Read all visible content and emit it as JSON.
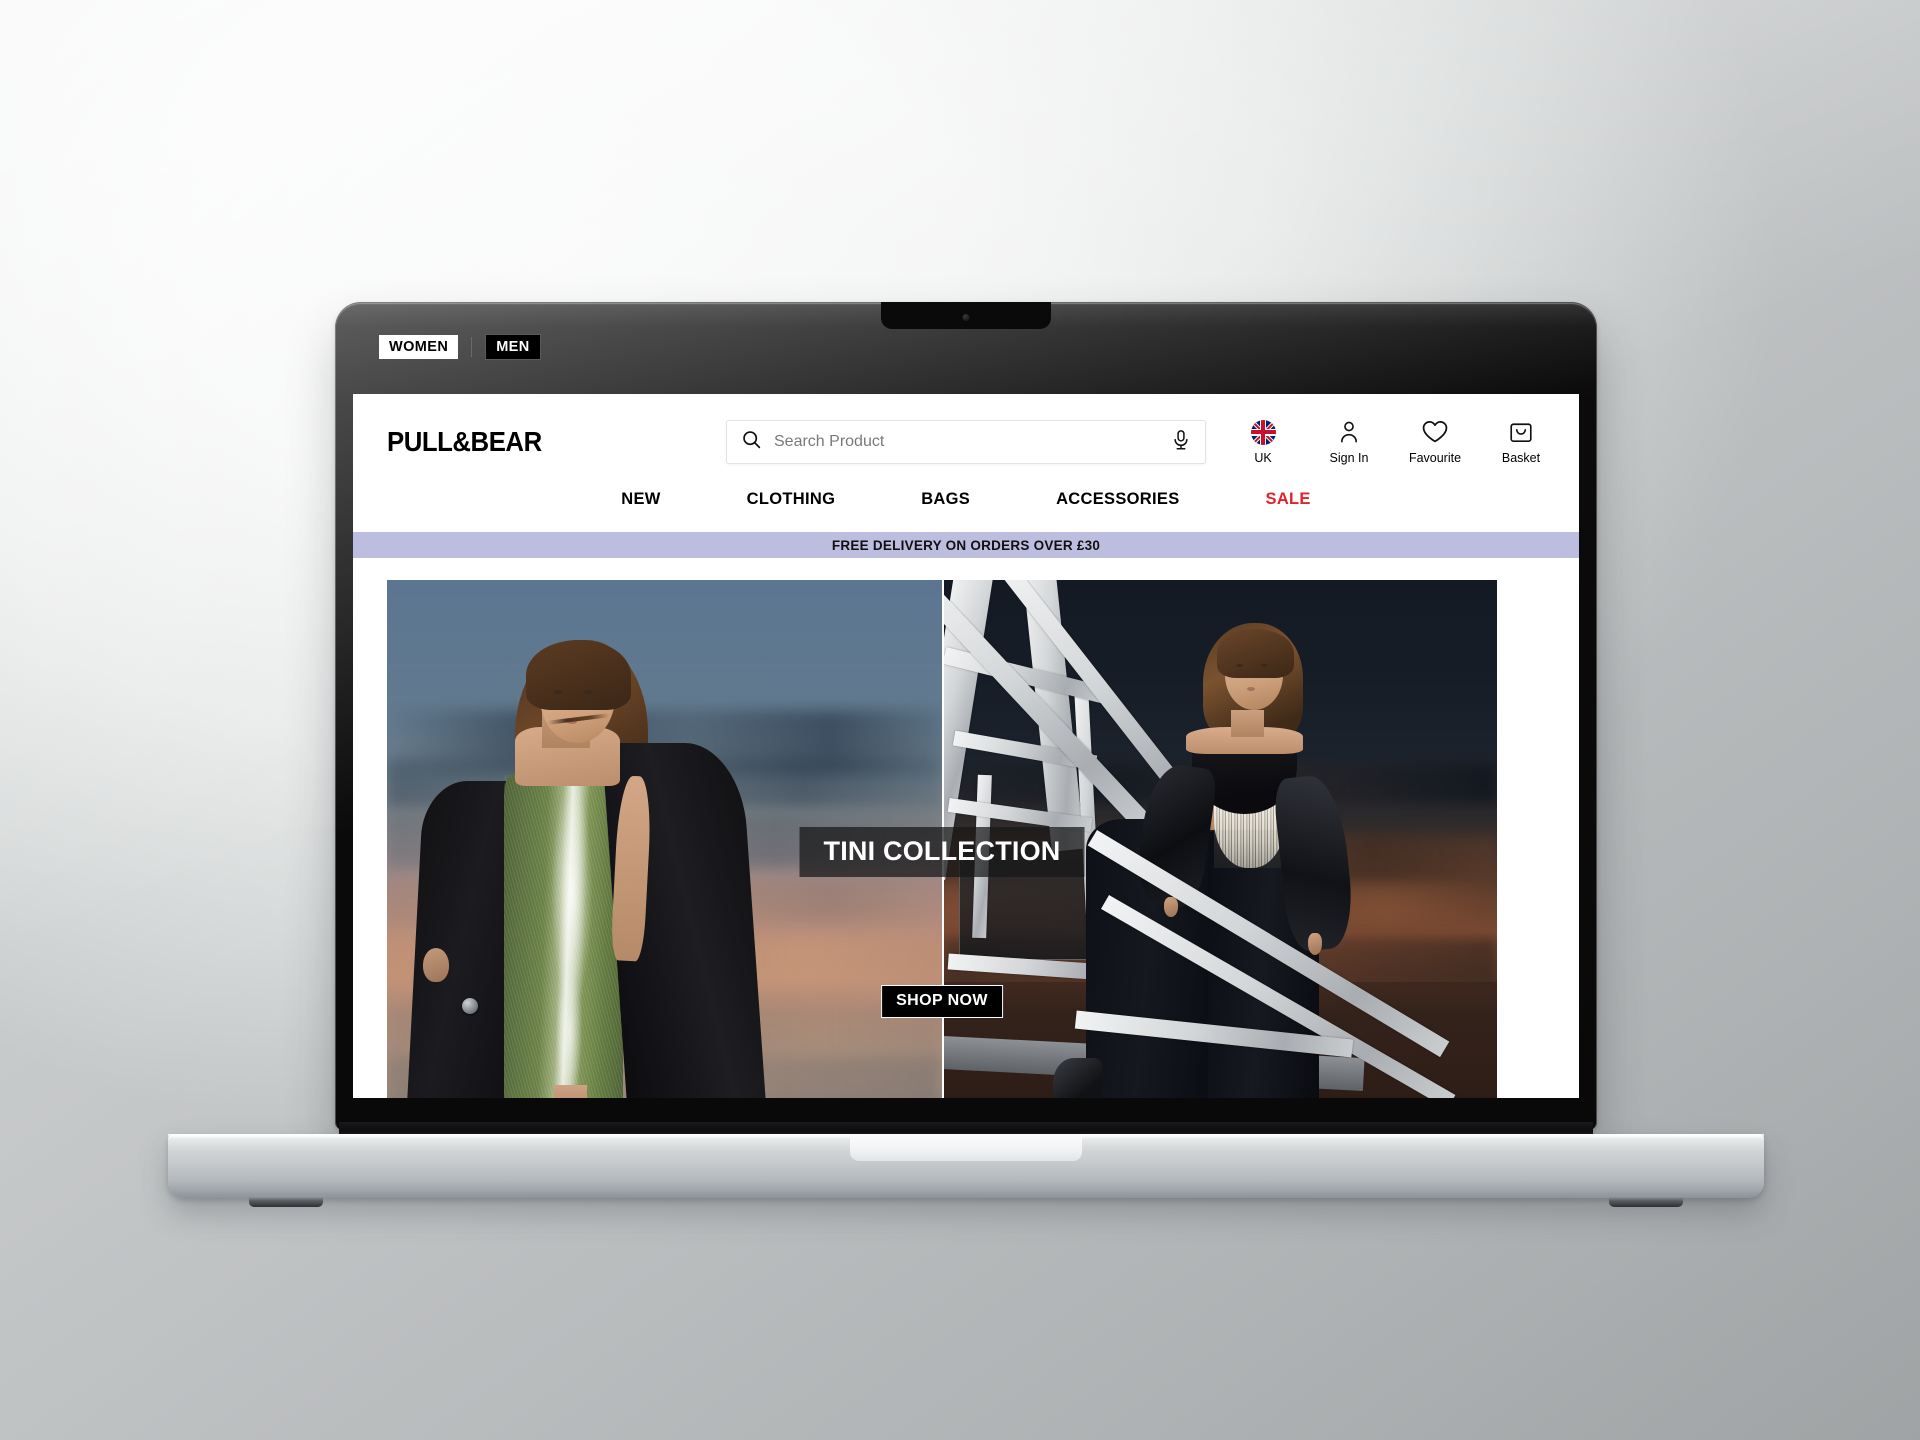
{
  "gender_switch": {
    "active": "WOMEN",
    "inactive": "MEN"
  },
  "brand": {
    "name": "PULL&BEAR"
  },
  "search": {
    "placeholder": "Search Product",
    "value": "",
    "search_icon": "search-icon",
    "mic_icon": "microphone-icon"
  },
  "header_icons": [
    {
      "icon": "uk-flag-icon",
      "label": "UK"
    },
    {
      "icon": "user-icon",
      "label": "Sign In"
    },
    {
      "icon": "heart-icon",
      "label": "Favourite"
    },
    {
      "icon": "shopping-bag-icon",
      "label": "Basket"
    }
  ],
  "nav": [
    {
      "label": "NEW",
      "sale": false
    },
    {
      "label": "CLOTHING",
      "sale": false
    },
    {
      "label": "BAGS",
      "sale": false
    },
    {
      "label": "ACCESSORIES",
      "sale": false
    },
    {
      "label": "SALE",
      "sale": true
    }
  ],
  "banner": {
    "text": "FREE DELIVERY ON ORDERS OVER £30",
    "background": "#bdbde0",
    "text_color": "#101010"
  },
  "hero": {
    "title": "TINI COLLECTION",
    "cta_label": "SHOP NOW",
    "left_image_alt": "Model in green sequin slip dress with black coat against blue and orange sunset sky",
    "right_image_alt": "Model in black fringed bandeau top and wide-leg trousers on white steel scaffolding at dusk"
  },
  "colors": {
    "sale_red": "#e0222a",
    "banner_purple": "#bdbde0",
    "black": "#000000",
    "white": "#ffffff"
  },
  "device": {
    "type": "laptop-mockup",
    "camera": "webcam-dot"
  }
}
